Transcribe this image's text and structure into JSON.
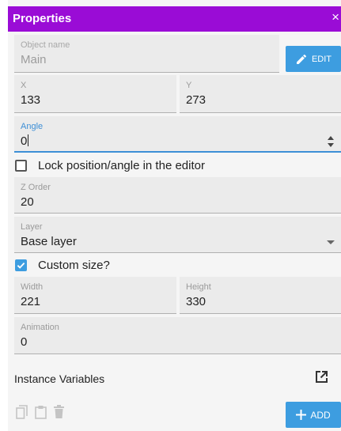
{
  "panel": {
    "title": "Properties",
    "close_glyph": "×"
  },
  "object_name": {
    "label": "Object name",
    "value": "Main",
    "edit_label": "EDIT",
    "edit_icon": "pencil-icon"
  },
  "position": {
    "x_label": "X",
    "x_value": "133",
    "y_label": "Y",
    "y_value": "273"
  },
  "angle": {
    "label": "Angle",
    "value": "0"
  },
  "lock": {
    "label": "Lock position/angle in the editor",
    "checked": false
  },
  "z_order": {
    "label": "Z Order",
    "value": "20"
  },
  "layer": {
    "label": "Layer",
    "value": "Base layer"
  },
  "custom_size": {
    "label": "Custom size?",
    "checked": true
  },
  "size": {
    "width_label": "Width",
    "width_value": "221",
    "height_label": "Height",
    "height_value": "330"
  },
  "animation": {
    "label": "Animation",
    "value": "0"
  },
  "instance_variables": {
    "label": "Instance Variables",
    "icon": "open-in-new-icon"
  },
  "toolbar": {
    "icons": [
      "copy-icon",
      "paste-icon",
      "delete-icon"
    ],
    "add_label": "ADD",
    "add_icon": "plus-icon"
  },
  "colors": {
    "title_bar": "#9a0cd6",
    "accent": "#3d9de0",
    "field_bg": "#ebebeb",
    "panel_bg": "#f5f5f5"
  }
}
